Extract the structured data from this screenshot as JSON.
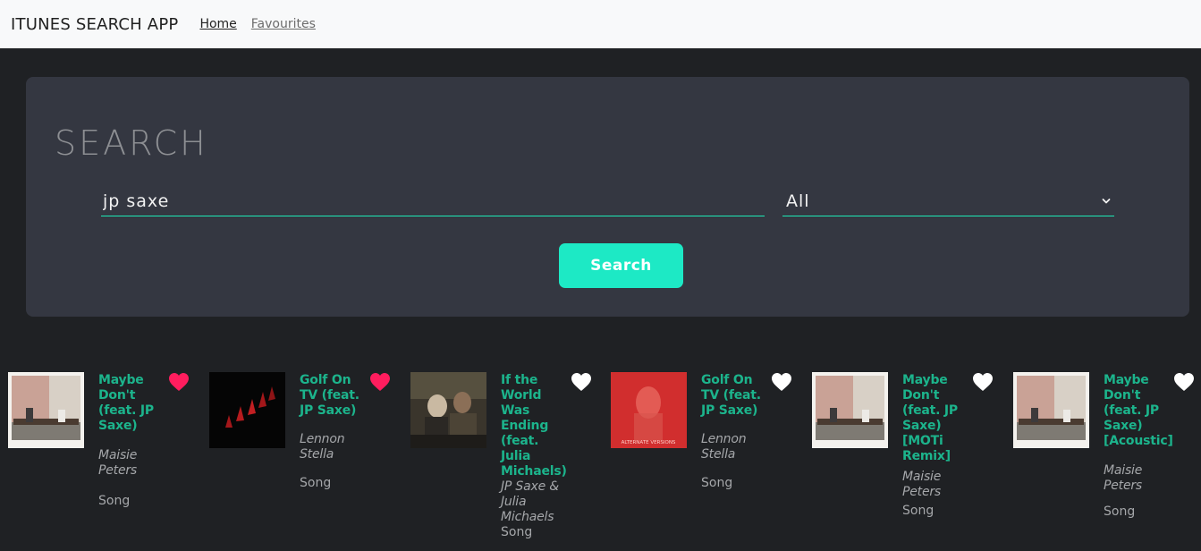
{
  "nav": {
    "brand": "ITUNES SEARCH APP",
    "home": "Home",
    "favourites": "Favourites"
  },
  "search": {
    "heading": "SEARCH",
    "query": "jp saxe",
    "media": "All",
    "button": "Search"
  },
  "colors": {
    "accent": "#1de9c5",
    "track_title": "#1cb48c",
    "heart_liked": "#ff1d5e",
    "heart_unliked": "#ffffff",
    "panel": "#343741",
    "background": "#1f2124"
  },
  "results": [
    {
      "track": "Maybe Don't (feat. JP Saxe)",
      "artist": "Maisie Peters",
      "kind": "Song",
      "favourited": true,
      "icon": "heart-icon"
    },
    {
      "track": "Golf On TV (feat. JP Saxe)",
      "artist": "Lennon Stella",
      "kind": "Song",
      "favourited": true,
      "icon": "heart-icon"
    },
    {
      "track": "If the World Was Ending (feat. Julia Michaels)",
      "artist": "JP Saxe & Julia Michaels",
      "kind": "Song",
      "favourited": false,
      "icon": "heart-icon"
    },
    {
      "track": "Golf On TV (feat. JP Saxe)",
      "artist": "Lennon Stella",
      "kind": "Song",
      "favourited": false,
      "icon": "heart-icon",
      "artwork_text": "ALTERNATE VERSIONS"
    },
    {
      "track": "Maybe Don't (feat. JP Saxe) [MOTi Remix]",
      "artist": "Maisie Peters",
      "kind": "Song",
      "favourited": false,
      "icon": "heart-icon"
    },
    {
      "track": "Maybe Don't (feat. JP Saxe) [Acoustic]",
      "artist": "Maisie Peters",
      "kind": "Song",
      "favourited": false,
      "icon": "heart-icon"
    }
  ]
}
